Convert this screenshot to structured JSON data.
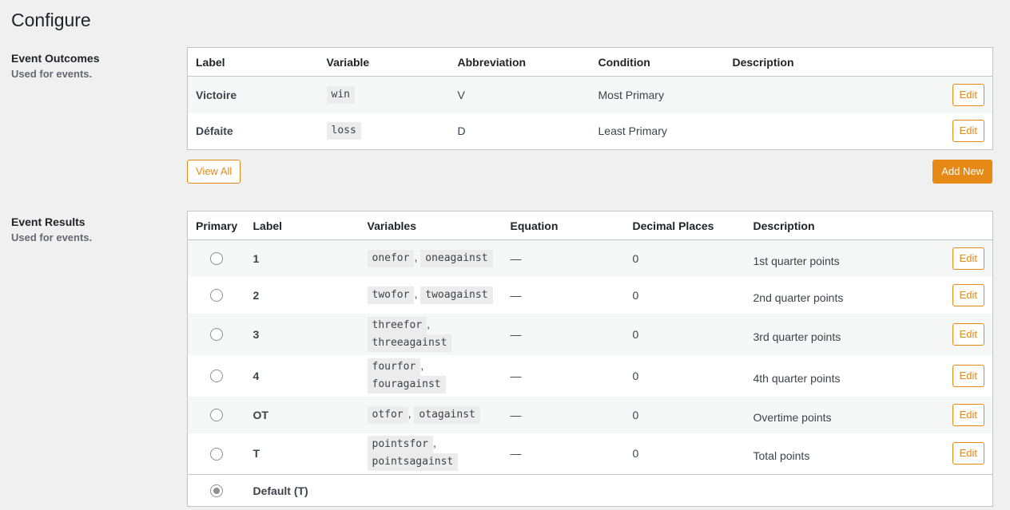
{
  "page_title": "Configure",
  "outcomes": {
    "title": "Event Outcomes",
    "desc": "Used for events.",
    "headers": [
      "Label",
      "Variable",
      "Abbreviation",
      "Condition",
      "Description"
    ],
    "rows": [
      {
        "label": "Victoire",
        "variable": "win",
        "abbr": "V",
        "condition": "Most Primary",
        "description": "",
        "edit": "Edit"
      },
      {
        "label": "Défaite",
        "variable": "loss",
        "abbr": "D",
        "condition": "Least Primary",
        "description": "",
        "edit": "Edit"
      }
    ],
    "view_all": "View All",
    "add_new": "Add New"
  },
  "results": {
    "title": "Event Results",
    "desc": "Used for events.",
    "headers": [
      "Primary",
      "Label",
      "Variables",
      "Equation",
      "Decimal Places",
      "Description"
    ],
    "rows": [
      {
        "label": "1",
        "vars": [
          "onefor",
          "oneagainst"
        ],
        "equation": "—",
        "decimals": "0",
        "description": "1st quarter points",
        "edit": "Edit"
      },
      {
        "label": "2",
        "vars": [
          "twofor",
          "twoagainst"
        ],
        "equation": "—",
        "decimals": "0",
        "description": "2nd quarter points",
        "edit": "Edit"
      },
      {
        "label": "3",
        "vars": [
          "threefor",
          "threeagainst"
        ],
        "equation": "—",
        "decimals": "0",
        "description": "3rd quarter points",
        "edit": "Edit"
      },
      {
        "label": "4",
        "vars": [
          "fourfor",
          "fouragainst"
        ],
        "equation": "—",
        "decimals": "0",
        "description": "4th quarter points",
        "edit": "Edit"
      },
      {
        "label": "OT",
        "vars": [
          "otfor",
          "otagainst"
        ],
        "equation": "—",
        "decimals": "0",
        "description": "Overtime points",
        "edit": "Edit"
      },
      {
        "label": "T",
        "vars": [
          "pointsfor",
          "pointsagainst"
        ],
        "equation": "—",
        "decimals": "0",
        "description": "Total points",
        "edit": "Edit"
      }
    ],
    "default_label": "Default (T)",
    "comma": ","
  }
}
